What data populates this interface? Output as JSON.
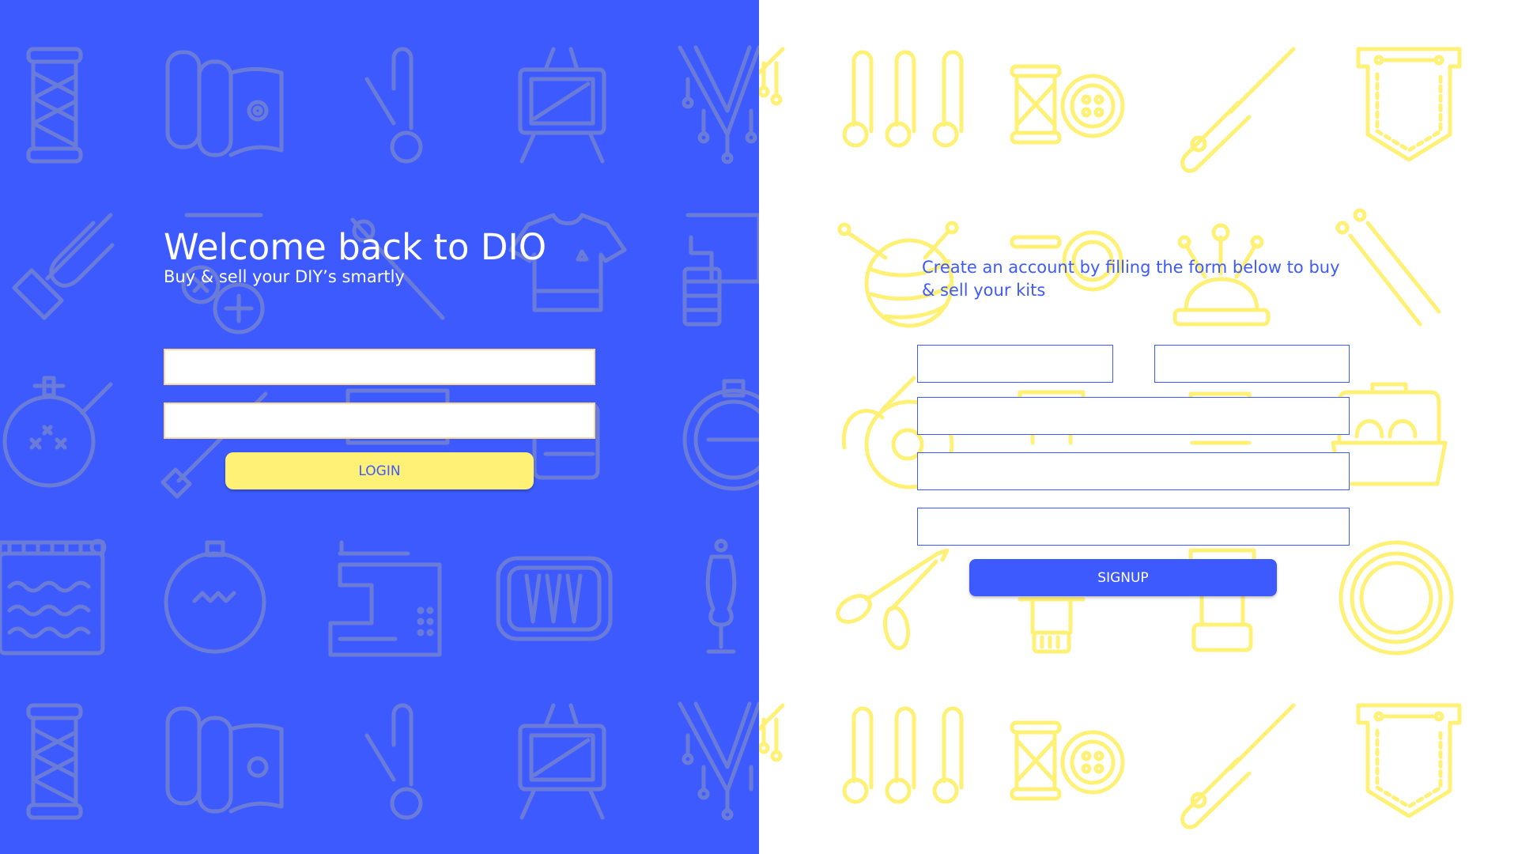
{
  "colors": {
    "primary_blue": "#3d5afe",
    "accent_yellow": "#fff176",
    "pattern_on_blue": "#6a7cd8",
    "pattern_on_white": "#fff176",
    "background_white": "#ffffff"
  },
  "login": {
    "title": "Welcome back to DIO",
    "subtitle": "Buy & sell your DIY’s smartly",
    "fields": [
      {
        "name": "login-field-1",
        "value": "",
        "placeholder": ""
      },
      {
        "name": "login-field-2",
        "value": "",
        "placeholder": ""
      }
    ],
    "button_label": "LOGIN"
  },
  "signup": {
    "intro": "Create an account by filling the form below to buy & sell your kits",
    "fields": [
      {
        "name": "signup-field-1",
        "value": "",
        "placeholder": ""
      },
      {
        "name": "signup-field-2",
        "value": "",
        "placeholder": ""
      },
      {
        "name": "signup-field-3",
        "value": "",
        "placeholder": ""
      },
      {
        "name": "signup-field-4",
        "value": "",
        "placeholder": ""
      },
      {
        "name": "signup-field-5",
        "value": "",
        "placeholder": ""
      }
    ],
    "button_label": "SIGNUP"
  },
  "background_icons": [
    "thread-spool-icon",
    "fabric-rolls-icon",
    "safety-pin-icon",
    "easel-canvas-icon",
    "macrame-icon",
    "seam-ripper-icon",
    "sewing-machine-icon",
    "t-shirt-icon",
    "button-icon",
    "embroidery-hoop-icon",
    "scissors-icon",
    "knitting-loom-icon",
    "needle-case-icon",
    "dress-form-icon",
    "pincushion-icon",
    "yarn-ball-icon",
    "knitting-needles-icon",
    "sewing-basket-icon",
    "pocket-icon",
    "measuring-tape-icon"
  ]
}
